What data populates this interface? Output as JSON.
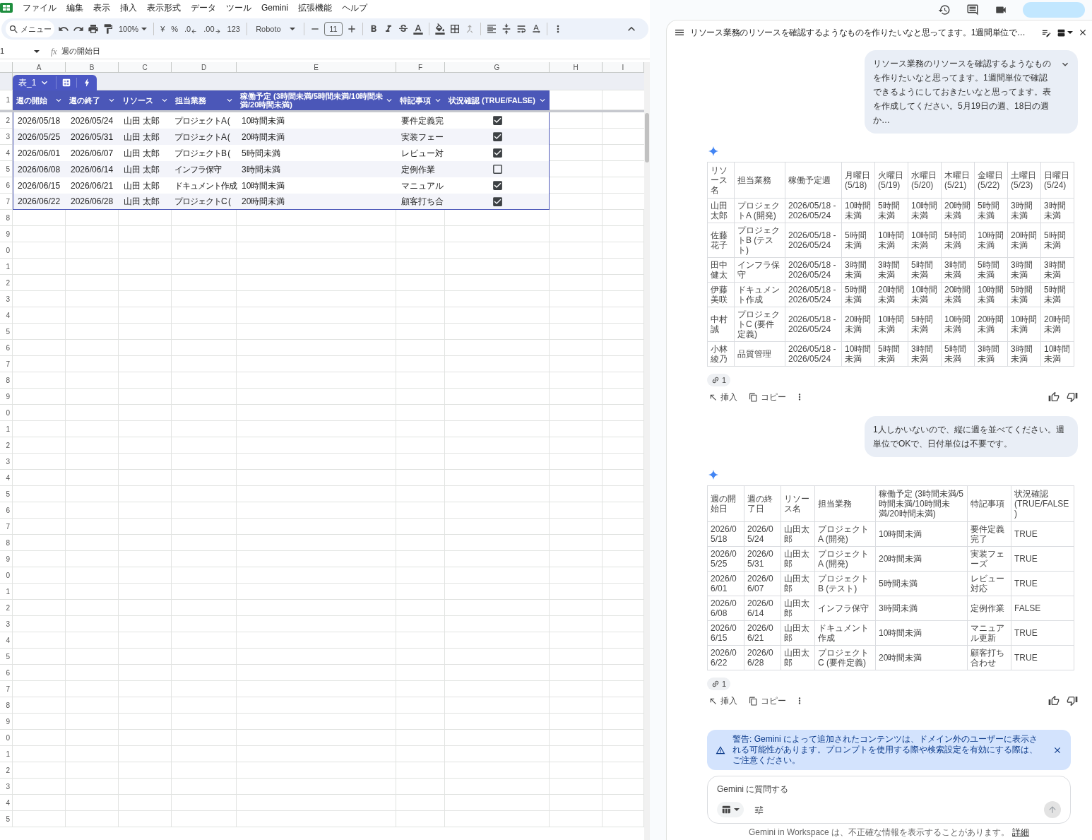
{
  "menu_bar": [
    "ファイル",
    "編集",
    "表示",
    "挿入",
    "表示形式",
    "データ",
    "ツール",
    "Gemini",
    "拡張機能",
    "ヘルプ"
  ],
  "toolbar": {
    "search": "メニュー",
    "zoom": "100%",
    "currency": "¥",
    "percent": "%",
    "decrease_decimal": ".0",
    "increase_decimal": ".00",
    "number_format": "123",
    "font": "Roboto",
    "font_size": "11"
  },
  "formula_bar": {
    "cell": "1",
    "function_label": "fx",
    "formula": "週の開始日"
  },
  "column_headers": [
    "A",
    "B",
    "C",
    "D",
    "E",
    "F",
    "G",
    "H",
    "I"
  ],
  "row_numbers": [
    "1",
    "2",
    "3",
    "4",
    "5",
    "6",
    "7",
    "8",
    "9",
    "0",
    "1",
    "2",
    "3",
    "4",
    "5",
    "6",
    "7",
    "8",
    "9",
    "0",
    "1",
    "2",
    "3",
    "4",
    "5",
    "6",
    "7",
    "8",
    "9",
    "0",
    "1",
    "2",
    "3",
    "4",
    "5",
    "6",
    "7",
    "8",
    "9",
    "0",
    "1",
    "2",
    "3",
    "4",
    "5"
  ],
  "sheet_table": {
    "name": "表_1",
    "columns": [
      "週の開始",
      "週の終了",
      "リソース",
      "担当業務",
      "稼働予定 (3時間未満/5時間未満/10時間未満/20時間未満)",
      "特記事項",
      "状況確認 (TRUE/FALSE)"
    ],
    "rows": [
      {
        "cells": [
          "2026/05/18",
          "2026/05/24",
          "山田 太郎",
          "プロジェクトA (",
          "10時間未満",
          "要件定義完"
        ],
        "checked": true
      },
      {
        "cells": [
          "2026/05/25",
          "2026/05/31",
          "山田 太郎",
          "プロジェクトA (",
          "20時間未満",
          "実装フェー"
        ],
        "checked": true
      },
      {
        "cells": [
          "2026/06/01",
          "2026/06/07",
          "山田 太郎",
          "プロジェクトB (",
          "5時間未満",
          "レビュー対"
        ],
        "checked": true
      },
      {
        "cells": [
          "2026/06/08",
          "2026/06/14",
          "山田 太郎",
          "インフラ保守",
          "3時間未満",
          "定例作業"
        ],
        "checked": false
      },
      {
        "cells": [
          "2026/06/15",
          "2026/06/21",
          "山田 太郎",
          "ドキュメント作成",
          "10時間未満",
          "マニュアル"
        ],
        "checked": true
      },
      {
        "cells": [
          "2026/06/22",
          "2026/06/28",
          "山田 太郎",
          "プロジェクトC (",
          "20時間未満",
          "顧客打ち合"
        ],
        "checked": true
      }
    ]
  },
  "chat": {
    "title": "リソース業務のリソースを確認するようなものを作りたいなと思ってます。1週間単位で…",
    "messages": [
      {
        "kind": "user",
        "expandable": true,
        "text": "リソース業務のリソースを確認するようなものを作りたいなと思ってます。1週間単位で確認できるようにしておきたいなと思ってます。表を作成してください。5月19日の週、18日の週か…"
      },
      {
        "kind": "model",
        "sources": "1",
        "actions": [
          "挿入",
          "コピー"
        ],
        "table": {
          "columns": [
            "リソース名",
            "担当業務",
            "稼働予定週",
            "月曜日 (5/18)",
            "火曜日 (5/19)",
            "水曜日 (5/20)",
            "木曜日 (5/21)",
            "金曜日 (5/22)",
            "土曜日 (5/23)",
            "日曜日 (5/24)"
          ],
          "rows": [
            [
              "山田太郎",
              "プロジェクトA (開発)",
              "2026/05/18 - 2026/05/24",
              "10時間未満",
              "5時間未満",
              "10時間未満",
              "20時間未満",
              "5時間未満",
              "3時間未満",
              "3時間未満"
            ],
            [
              "佐藤花子",
              "プロジェクトB (テスト)",
              "2026/05/18 - 2026/05/24",
              "5時間未満",
              "10時間未満",
              "10時間未満",
              "5時間未満",
              "10時間未満",
              "20時間未満",
              "5時間未満"
            ],
            [
              "田中健太",
              "インフラ保守",
              "2026/05/18 - 2026/05/24",
              "3時間未満",
              "3時間未満",
              "5時間未満",
              "3時間未満",
              "5時間未満",
              "3時間未満",
              "3時間未満"
            ],
            [
              "伊藤美咲",
              "ドキュメント作成",
              "2026/05/18 - 2026/05/24",
              "5時間未満",
              "20時間未満",
              "10時間未満",
              "20時間未満",
              "10時間未満",
              "5時間未満",
              "5時間未満"
            ],
            [
              "中村誠",
              "プロジェクトC (要件定義)",
              "2026/05/18 - 2026/05/24",
              "20時間未満",
              "10時間未満",
              "5時間未満",
              "10時間未満",
              "20時間未満",
              "10時間未満",
              "20時間未満"
            ],
            [
              "小林綾乃",
              "品質管理",
              "2026/05/18 - 2026/05/24",
              "10時間未満",
              "5時間未満",
              "3時間未満",
              "5時間未満",
              "3時間未満",
              "3時間未満",
              "10時間未満"
            ]
          ]
        }
      },
      {
        "kind": "user",
        "expandable": false,
        "text": "1人しかいないので、縦に週を並べてください。週単位でOKで、日付単位は不要です。"
      },
      {
        "kind": "model",
        "sources": "1",
        "actions": [
          "挿入",
          "コピー"
        ],
        "table": {
          "columns": [
            "週の開始日",
            "週の終了日",
            "リソース名",
            "担当業務",
            "稼働予定 (3時間未満/5時間未満/10時間未満/20時間未満)",
            "特記事項",
            "状況確認 (TRUE/FALSE)"
          ],
          "rows": [
            [
              "2026/05/18",
              "2026/05/24",
              "山田太郎",
              "プロジェクトA (開発)",
              "10時間未満",
              "要件定義完了",
              "TRUE"
            ],
            [
              "2026/05/25",
              "2026/05/31",
              "山田太郎",
              "プロジェクトA (開発)",
              "20時間未満",
              "実装フェーズ",
              "TRUE"
            ],
            [
              "2026/06/01",
              "2026/06/07",
              "山田太郎",
              "プロジェクトB (テスト)",
              "5時間未満",
              "レビュー対応",
              "TRUE"
            ],
            [
              "2026/06/08",
              "2026/06/14",
              "山田太郎",
              "インフラ保守",
              "3時間未満",
              "定例作業",
              "FALSE"
            ],
            [
              "2026/06/15",
              "2026/06/21",
              "山田太郎",
              "ドキュメント作成",
              "10時間未満",
              "マニュアル更新",
              "TRUE"
            ],
            [
              "2026/06/22",
              "2026/06/28",
              "山田太郎",
              "プロジェクトC (要件定義)",
              "20時間未満",
              "顧客打ち合わせ",
              "TRUE"
            ]
          ]
        }
      }
    ]
  },
  "warning": {
    "text": "警告: Gemini によって追加されたコンテンツは、ドメイン外のユーザーに表示される可能性があります。プロンプトを使用する際や検索設定を有効にする際は、ご注意ください。"
  },
  "input": {
    "placeholder": "Gemini に質問する"
  },
  "footer": {
    "text": "Gemini in Workspace は、不正確な情報を表示することがあります。",
    "link": "詳細"
  }
}
